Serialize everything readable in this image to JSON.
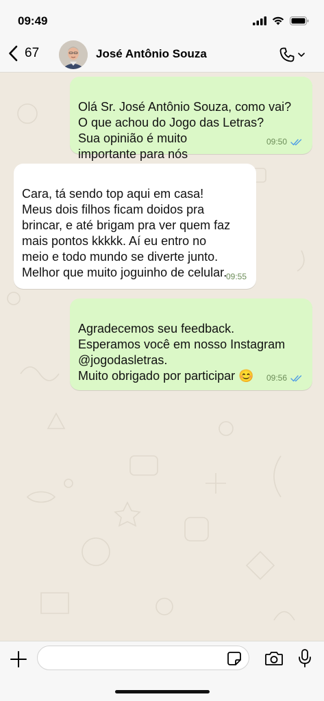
{
  "status_bar": {
    "time": "09:49",
    "icons": [
      "signal-icon",
      "wifi-icon",
      "battery-icon"
    ]
  },
  "header": {
    "back_count": "67",
    "contact_name": "José Antônio Souza",
    "icons": [
      "chevron-left-icon",
      "phone-icon",
      "chevron-down-icon"
    ]
  },
  "messages": [
    {
      "direction": "out",
      "text": "Olá Sr. José Antônio Souza, como vai?\nO que achou do Jogo das Letras?\nSua opinião é muito\nimportante para nós",
      "time": "09:50",
      "read": true
    },
    {
      "direction": "in",
      "text": "Cara, tá sendo top aqui em casa!\nMeus dois filhos ficam doidos pra\nbrincar, e até brigam pra ver quem faz\nmais pontos kkkkk. Aí eu entro no\nmeio e todo mundo se diverte junto.\nMelhor que muito joguinho de celular.",
      "time": "09:55"
    },
    {
      "direction": "out",
      "text": "Agradecemos seu feedback.\nEsperamos você em nosso Instagram\n@jogodasletras.\nMuito obrigado por participar 😊",
      "time": "09:56",
      "read": true
    }
  ],
  "input_bar": {
    "placeholder": "",
    "icons": [
      "plus-icon",
      "sticker-icon",
      "camera-icon",
      "microphone-icon"
    ]
  },
  "colors": {
    "outgoing_bubble": "#dbf8c7",
    "incoming_bubble": "#ffffff",
    "read_ticks": "#4f9de6",
    "chat_background": "#efe9df"
  }
}
